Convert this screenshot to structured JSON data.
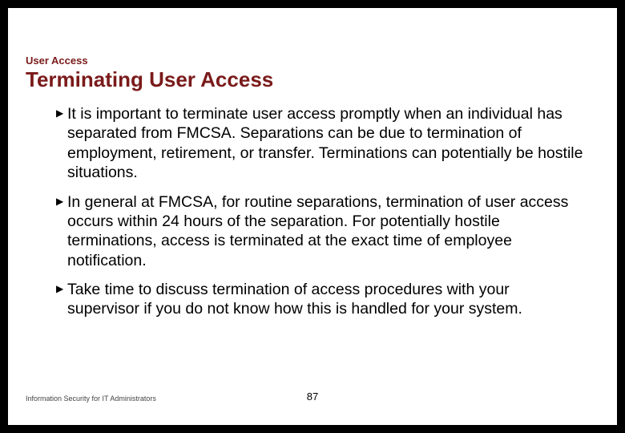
{
  "section_label": "User Access",
  "title": "Terminating User Access",
  "bullets": [
    "It is important to terminate user access promptly when an individual has separated from FMCSA. Separations can be due to termination of employment, retirement, or transfer. Terminations can potentially be hostile situations.",
    "In general at FMCSA, for routine separations, termination of user access occurs within 24 hours of the separation. For potentially hostile terminations, access is terminated at the exact time of employee notification.",
    "Take time to discuss termination of access procedures with your supervisor if you do not know how this is handled for your system."
  ],
  "footer": {
    "left": "Information Security for IT Administrators",
    "page": "87"
  }
}
